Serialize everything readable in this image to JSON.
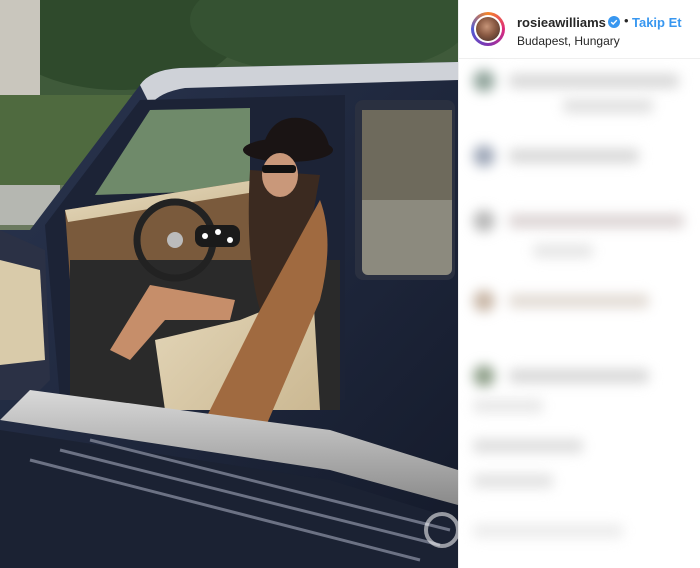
{
  "post": {
    "image_description_icon": "photo-woman-in-vintage-car",
    "watermark_icon": "watermark-logo"
  },
  "header": {
    "username": "rosieawilliams",
    "verified_icon": "verified-badge-icon",
    "separator": "•",
    "follow_label": "Takip Et",
    "location": "Budapest, Hungary"
  },
  "colors": {
    "follow_blue": "#3897f0",
    "verified_blue": "#3897f0",
    "text": "#262626"
  },
  "comments": {
    "blurred": true
  }
}
